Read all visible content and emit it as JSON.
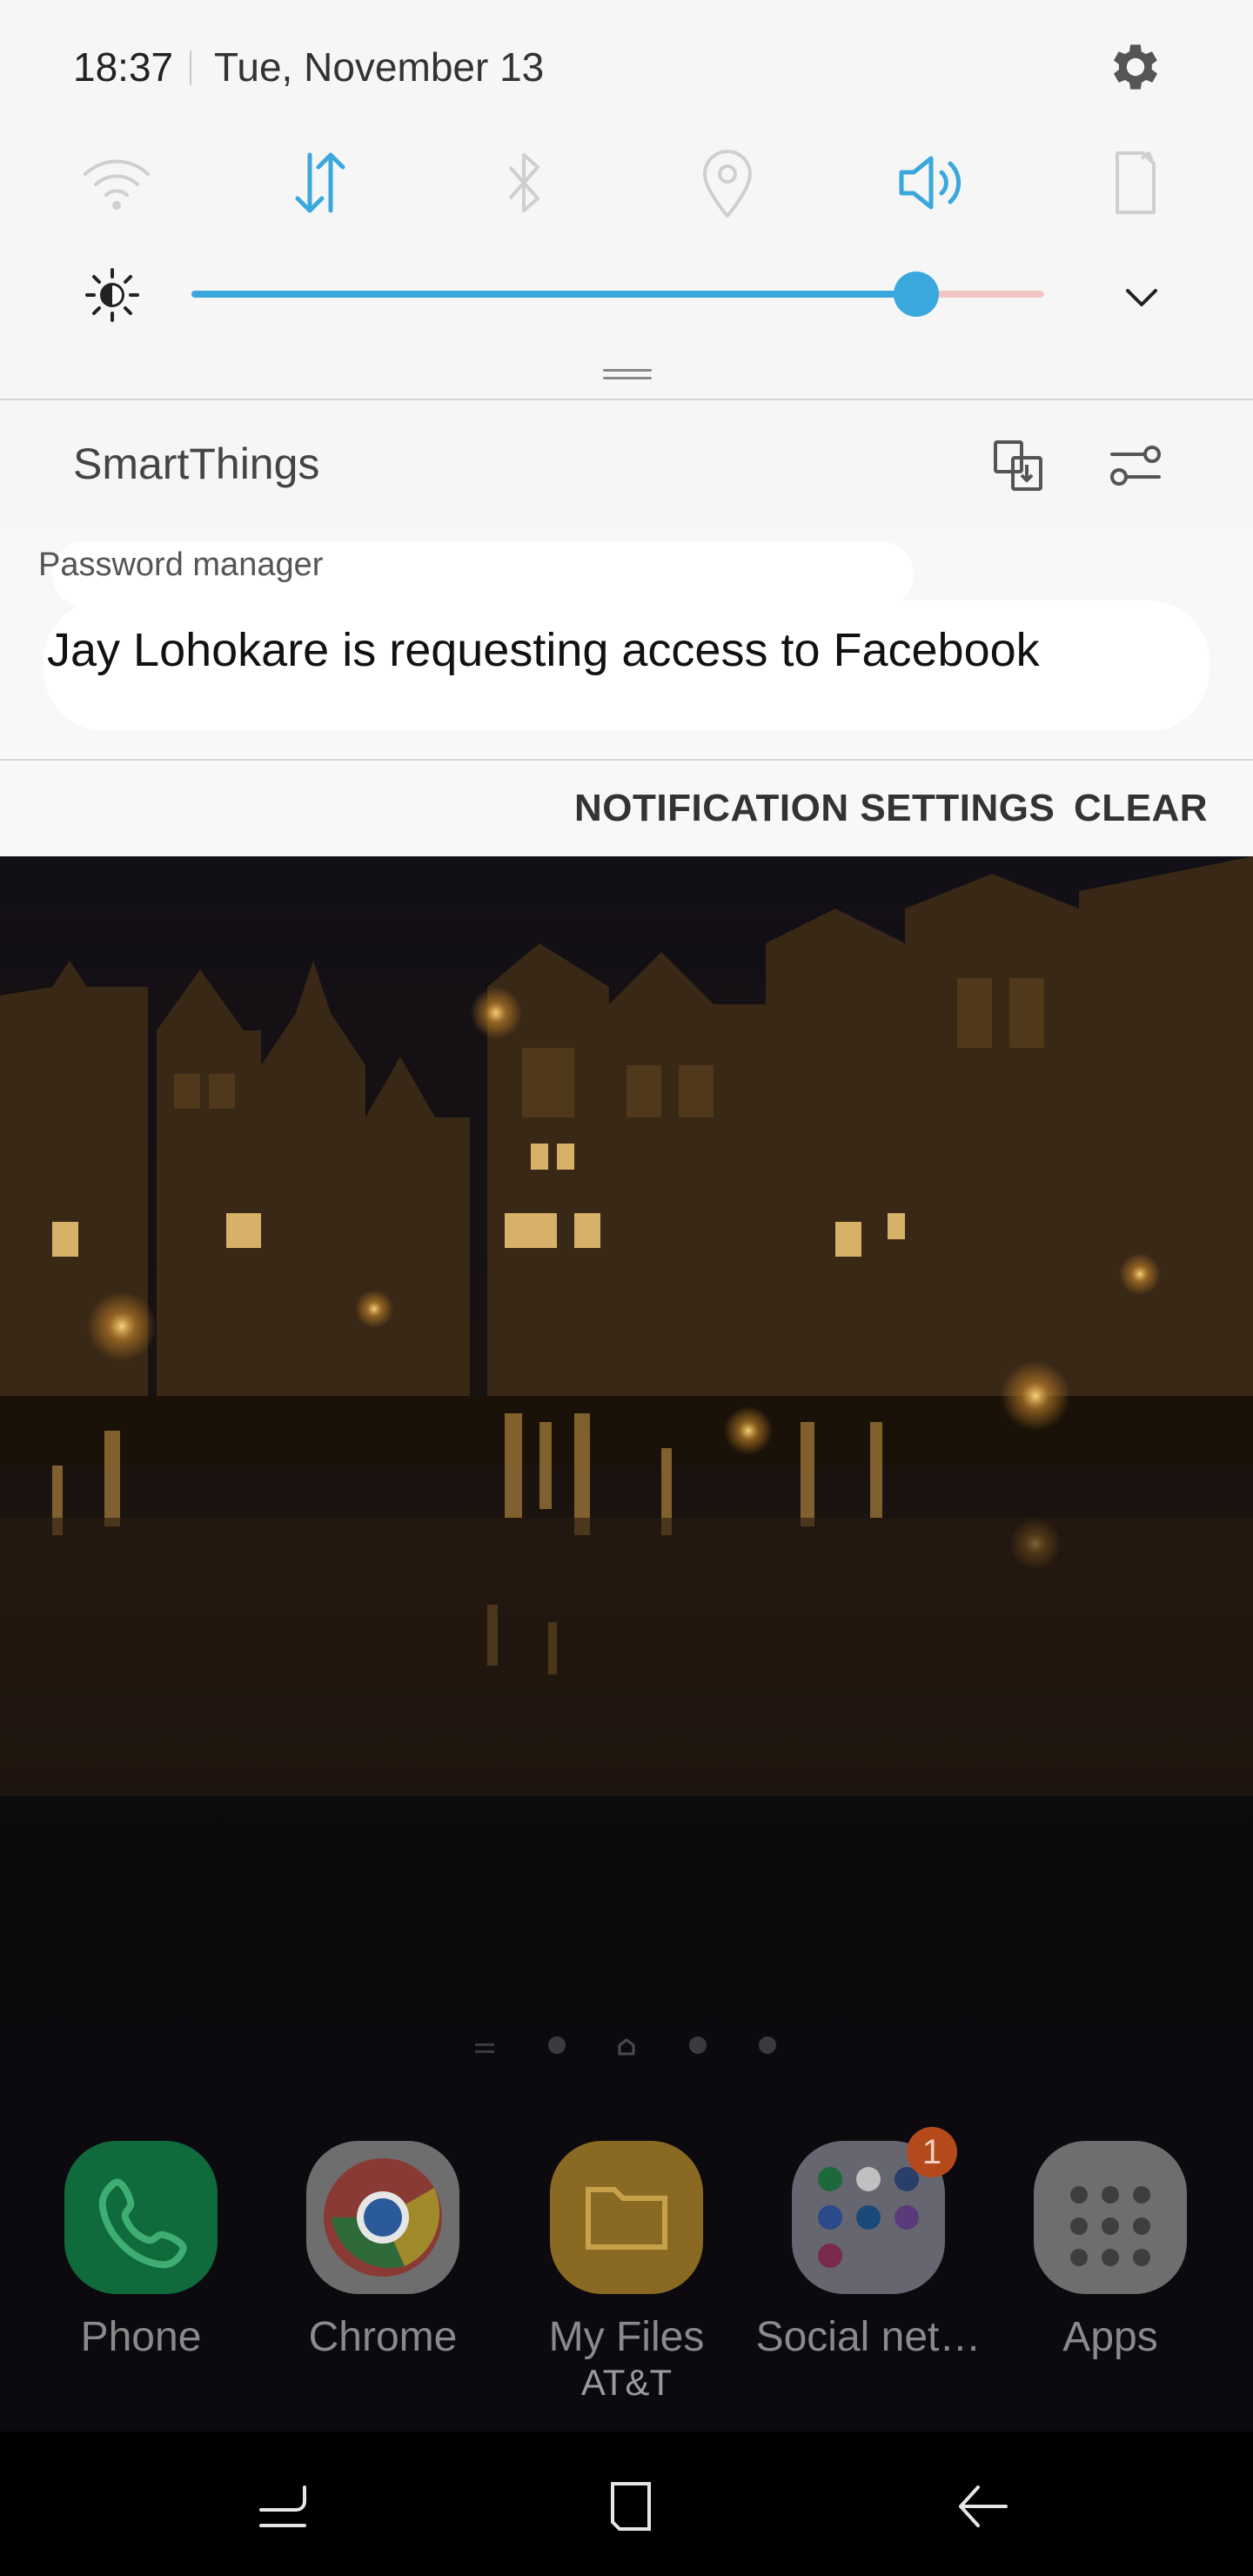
{
  "status": {
    "time": "18:37",
    "date": "Tue, November 13"
  },
  "quick_panel": {
    "toggles": [
      {
        "icon": "wifi-icon",
        "active": false
      },
      {
        "icon": "mobile-data-icon",
        "active": true
      },
      {
        "icon": "bluetooth-icon",
        "active": false
      },
      {
        "icon": "location-icon",
        "active": false
      },
      {
        "icon": "sound-icon",
        "active": true
      },
      {
        "icon": "auto-rotate-icon",
        "active": false
      }
    ],
    "brightness_level": 0.85,
    "accent_color": "#3aa8dc"
  },
  "smartthings": {
    "title": "SmartThings"
  },
  "notification": {
    "app": "Password manager",
    "text": "Jay Lohokare is requesting access to Facebook"
  },
  "actions": {
    "settings_label": "NOTIFICATION SETTINGS",
    "clear_label": "CLEAR"
  },
  "dock": {
    "apps": [
      {
        "label": "Phone",
        "icon": "phone-icon"
      },
      {
        "label": "Chrome",
        "icon": "chrome-icon"
      },
      {
        "label": "My Files",
        "icon": "folder-icon"
      },
      {
        "label": "Social net…",
        "icon": "social-folder-icon",
        "badge": "1"
      },
      {
        "label": "Apps",
        "icon": "apps-grid-icon"
      }
    ],
    "carrier": "AT&T"
  },
  "navbar": {
    "buttons": [
      "recents-button",
      "home-button",
      "back-button"
    ]
  }
}
